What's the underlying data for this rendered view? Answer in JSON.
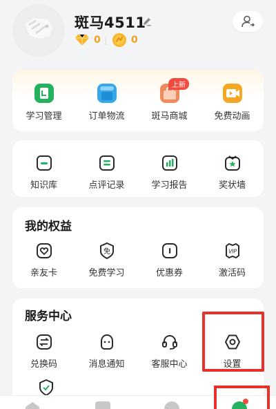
{
  "profile": {
    "username": "斑马4511",
    "diamond_count": "0",
    "coin_count": "0"
  },
  "colors": {
    "green": "#25b25e",
    "blue": "#35a8ea",
    "orange": "#f08a5d",
    "amber": "#f5a623",
    "badge_red": "#f24b3f",
    "highlight_red": "#e8312a"
  },
  "quick_menu": [
    {
      "label": "学习管理",
      "icon": "study-manage-icon"
    },
    {
      "label": "订单物流",
      "icon": "order-logistics-icon"
    },
    {
      "label": "斑马商城",
      "icon": "mall-icon",
      "badge": "上新"
    },
    {
      "label": "免费动画",
      "icon": "free-animation-icon"
    }
  ],
  "tools_menu": [
    {
      "label": "知识库",
      "icon": "knowledge-base-icon"
    },
    {
      "label": "点评记录",
      "icon": "review-records-icon"
    },
    {
      "label": "学习报告",
      "icon": "study-report-icon"
    },
    {
      "label": "奖状墙",
      "icon": "certificate-wall-icon"
    }
  ],
  "benefits": {
    "title": "我的权益",
    "items": [
      {
        "label": "亲友卡",
        "icon": "friend-card-icon"
      },
      {
        "label": "免费学习",
        "icon": "free-study-icon"
      },
      {
        "label": "优惠券",
        "icon": "coupon-icon"
      },
      {
        "label": "激活码",
        "icon": "vip-activation-icon"
      }
    ]
  },
  "service": {
    "title": "服务中心",
    "items": [
      {
        "label": "兑换码",
        "icon": "exchange-icon"
      },
      {
        "label": "消息通知",
        "icon": "notification-icon"
      },
      {
        "label": "客服中心",
        "icon": "headset-icon"
      },
      {
        "label": "设置",
        "icon": "settings-icon"
      }
    ]
  },
  "tabbar": [
    "home-icon",
    "book-icon",
    "compass-icon",
    "me-icon"
  ]
}
